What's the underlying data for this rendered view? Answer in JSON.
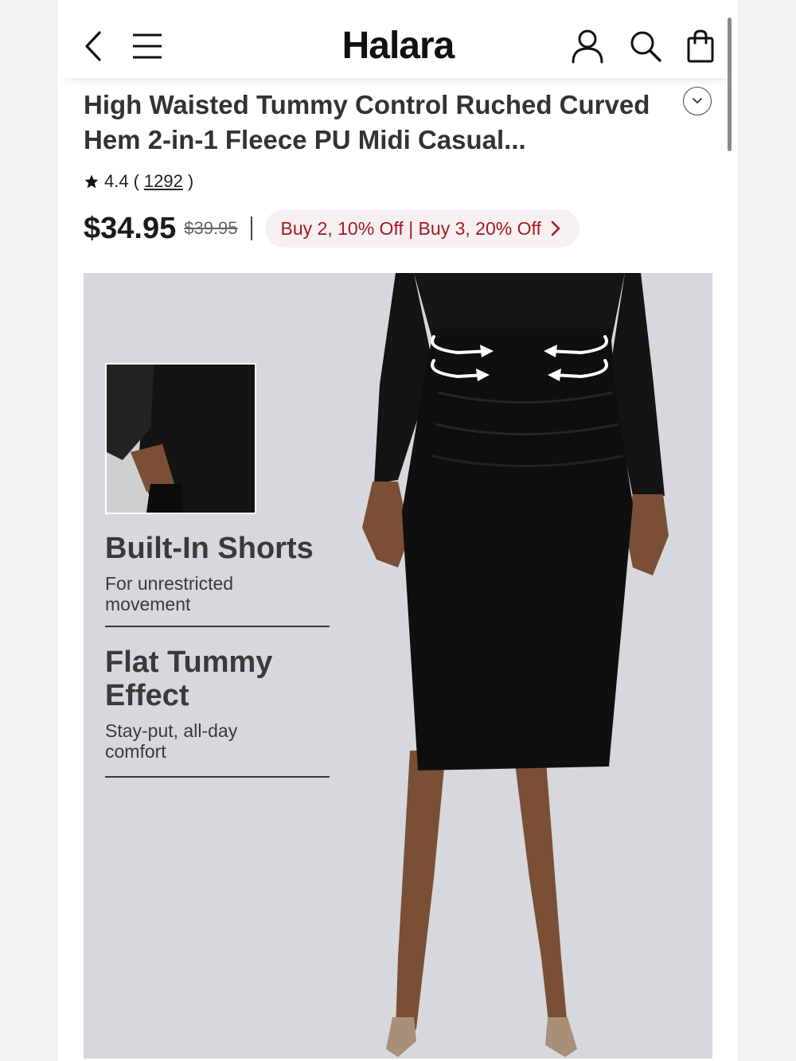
{
  "header": {
    "brand": "Halara",
    "icons": [
      "back-chevron-icon",
      "hamburger-menu-icon",
      "account-icon",
      "search-icon",
      "shopping-bag-icon"
    ]
  },
  "product": {
    "title": "High Waisted Tummy Control Ruched Curved Hem 2-in-1 Fleece PU Midi Casual...",
    "rating": "4.4",
    "review_count": "1292",
    "price": "$34.95",
    "original_price": "$39.95",
    "promo": "Buy 2, 10% Off | Buy 3, 20% Off"
  },
  "image_overlay": {
    "features": [
      {
        "title": "Built-In Shorts",
        "subtitle": "For unrestricted movement"
      },
      {
        "title": "Flat Tummy Effect",
        "subtitle": "Stay-put, all-day comfort"
      }
    ]
  },
  "colors": {
    "promo_text": "#a31a24",
    "promo_bg": "#f6f0f0",
    "image_bg": "#d6d8dd"
  }
}
